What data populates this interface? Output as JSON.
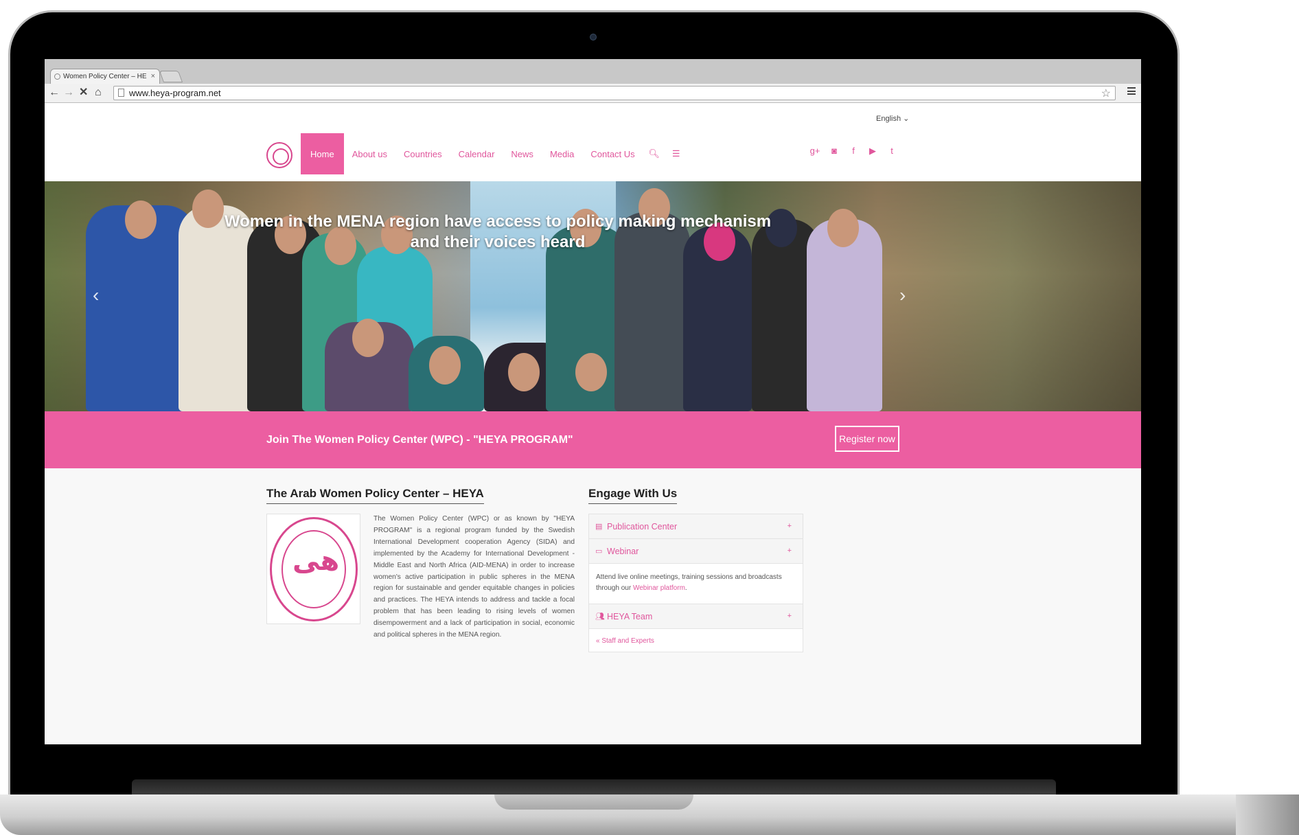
{
  "browser": {
    "tab_title": "Women Policy Center – HE",
    "tab_close": "×",
    "url": "www.heya-program.net"
  },
  "header": {
    "language": "English ⌄",
    "nav": [
      {
        "label": "Home",
        "active": true
      },
      {
        "label": "About us"
      },
      {
        "label": "Countries"
      },
      {
        "label": "Calendar"
      },
      {
        "label": "News"
      },
      {
        "label": "Media"
      },
      {
        "label": "Contact Us"
      }
    ],
    "nav_icons": [
      "search-icon",
      "list-icon"
    ],
    "social": [
      "google-plus-icon",
      "instagram-icon",
      "facebook-icon",
      "youtube-icon",
      "twitter-icon"
    ]
  },
  "hero": {
    "title": "Women in the MENA region have access to policy making mechanism and their voices heard"
  },
  "join": {
    "text": "Join The Women Policy Center (WPC) - \"HEYA PROGRAM\"",
    "button": "Register now"
  },
  "about": {
    "title": "The Arab Women Policy Center – HEYA",
    "body": "The Women Policy Center (WPC) or as known by \"HEYA PROGRAM\" is a regional program funded by the Swedish International Development cooperation Agency (SIDA) and implemented by the Academy for International Development - Middle East and North Africa (AID-MENA) in order to increase women's active participation in public spheres in the MENA region for sustainable and gender equitable changes in policies and practices. The HEYA intends to address and tackle a focal problem that has been leading to rising levels of women disempowerment and a lack of participation in social, economic and political spheres in the MENA region."
  },
  "engage": {
    "title": "Engage With Us",
    "items": [
      {
        "label": "Publication Center",
        "icon": "document-icon"
      },
      {
        "label": "Webinar",
        "icon": "laptop-icon",
        "body": "Attend live online meetings, training sessions and broadcasts through our",
        "link": "Webinar platform",
        "after": "."
      },
      {
        "label": "HEYA Team",
        "icon": "users-icon",
        "sub": "« Staff and Experts"
      }
    ],
    "plus": "+"
  },
  "colors": {
    "accent": "#ec5ea1",
    "accent_text": "#e0569c"
  }
}
